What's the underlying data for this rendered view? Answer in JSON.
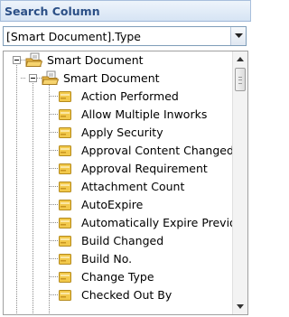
{
  "panel": {
    "title": "Search Column"
  },
  "combo": {
    "value": "[Smart Document].Type",
    "icon": "chevron-down-icon"
  },
  "tree": {
    "root": {
      "label": "Smart Document",
      "icon": "folder-document-icon",
      "expanded": true
    },
    "child": {
      "label": "Smart Document",
      "icon": "folder-document-icon",
      "expanded": true
    },
    "fields": [
      {
        "label": "Action Performed",
        "icon": "field-icon"
      },
      {
        "label": "Allow Multiple Inworks",
        "icon": "field-icon"
      },
      {
        "label": "Apply Security",
        "icon": "field-icon"
      },
      {
        "label": "Approval Content Changed",
        "icon": "field-icon"
      },
      {
        "label": "Approval Requirement",
        "icon": "field-icon"
      },
      {
        "label": "Attachment Count",
        "icon": "field-icon"
      },
      {
        "label": "AutoExpire",
        "icon": "field-icon"
      },
      {
        "label": "Automatically Expire Previou",
        "icon": "field-icon"
      },
      {
        "label": "Build Changed",
        "icon": "field-icon"
      },
      {
        "label": "Build No.",
        "icon": "field-icon"
      },
      {
        "label": "Change Type",
        "icon": "field-icon"
      },
      {
        "label": "Checked Out By",
        "icon": "field-icon"
      }
    ]
  },
  "scrollbar": {
    "up_icon": "arrow-up-icon",
    "down_icon": "arrow-down-icon"
  },
  "colors": {
    "title_text": "#2b4f86",
    "title_bg": "#d6e4f4",
    "field_icon": "#f2c94c"
  }
}
